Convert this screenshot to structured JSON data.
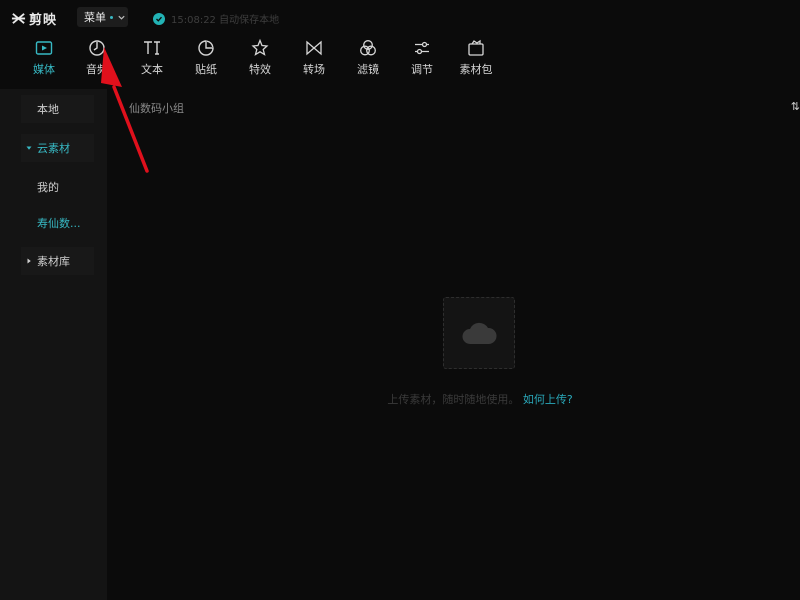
{
  "app": {
    "logo_text": "剪映",
    "menu_label": "菜单",
    "save_status": "15:08:22 自动保存本地"
  },
  "toolbar": {
    "items": [
      {
        "label": "媒体",
        "icon": "media-icon",
        "active": true
      },
      {
        "label": "音频",
        "icon": "audio-icon",
        "active": false
      },
      {
        "label": "文本",
        "icon": "text-icon",
        "active": false
      },
      {
        "label": "贴纸",
        "icon": "sticker-icon",
        "active": false
      },
      {
        "label": "特效",
        "icon": "effects-icon",
        "active": false
      },
      {
        "label": "转场",
        "icon": "transition-icon",
        "active": false
      },
      {
        "label": "滤镜",
        "icon": "filter-icon",
        "active": false
      },
      {
        "label": "调节",
        "icon": "adjust-icon",
        "active": false
      },
      {
        "label": "素材包",
        "icon": "material-pack-icon",
        "active": false
      }
    ]
  },
  "sidebar": {
    "items": [
      {
        "label": "本地"
      },
      {
        "label": "云素材"
      },
      {
        "label": "我的"
      },
      {
        "label": "寿仙数..."
      },
      {
        "label": "素材库"
      }
    ]
  },
  "content": {
    "group_title": "仙数码小组",
    "sort_icon_text": "⇅",
    "empty_hint": "上传素材，随时随地使用。",
    "empty_link": "如何上传?"
  },
  "colors": {
    "accent": "#37b9c4",
    "background": "#0b0b0b",
    "panel": "#141414",
    "annotation_arrow": "#e0101c"
  }
}
